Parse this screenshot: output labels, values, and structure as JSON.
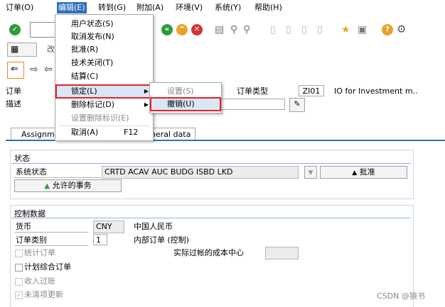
{
  "menu_bar": [
    {
      "label": "订单(O)"
    },
    {
      "label": "编辑(E)"
    },
    {
      "label": "转到(G)"
    },
    {
      "label": "附加(A)"
    },
    {
      "label": "环境(V)"
    },
    {
      "label": "系统(Y)"
    },
    {
      "label": "帮助(H)"
    }
  ],
  "edit_menu": {
    "items": [
      {
        "label": "用户状态(S)"
      },
      {
        "label": "取消发布(N)"
      },
      {
        "label": "批准(R)"
      },
      {
        "label": "技术关闭(T)"
      },
      {
        "label": "结算(C)"
      },
      {
        "label": "锁定(L)"
      },
      {
        "label": "删除标记(D)"
      },
      {
        "label": "设置删除标识(E)"
      },
      {
        "label": "取消(A)",
        "shortcut": "F12"
      }
    ],
    "lock_submenu": [
      {
        "label": "设置(S)"
      },
      {
        "label": "撤销(U)"
      }
    ]
  },
  "toolbar": {
    "second_row_text": "改"
  },
  "header": {
    "order_label": "订单",
    "order_type_label": "订单类型",
    "order_type_value": "ZI01",
    "order_type_desc": "IO for Investment m..",
    "description_label": "描述"
  },
  "tabs": {
    "assignment": "Assignme",
    "general": "neral data"
  },
  "status_section": {
    "title": "状态",
    "system_status_label": "系统状态",
    "system_status_value": "CRTD ACAV AUC  BUDG ISBD LKD",
    "approve_button": "批准",
    "allowed_tx_button": "允许的事务"
  },
  "control_section": {
    "title": "控制数据",
    "currency_label": "货币",
    "currency_value": "CNY",
    "currency_desc": "中国人民币",
    "order_category_label": "订单类别",
    "order_category_value": "1",
    "order_category_desc": "内部订单 (控制)",
    "stat_order_label": "统计订单",
    "actual_cost_center_label": "实际过帐的成本中心",
    "plan_integrated_label": "计划综合订单",
    "revenue_posting_label": "收入过账",
    "commitment_update_label": "未清项更新"
  },
  "watermark": "CSDN @狼书",
  "colors": {
    "menu_highlight": "#2f6fbe",
    "callout_red": "#e8202a",
    "section_line": "#8fb2d9"
  }
}
